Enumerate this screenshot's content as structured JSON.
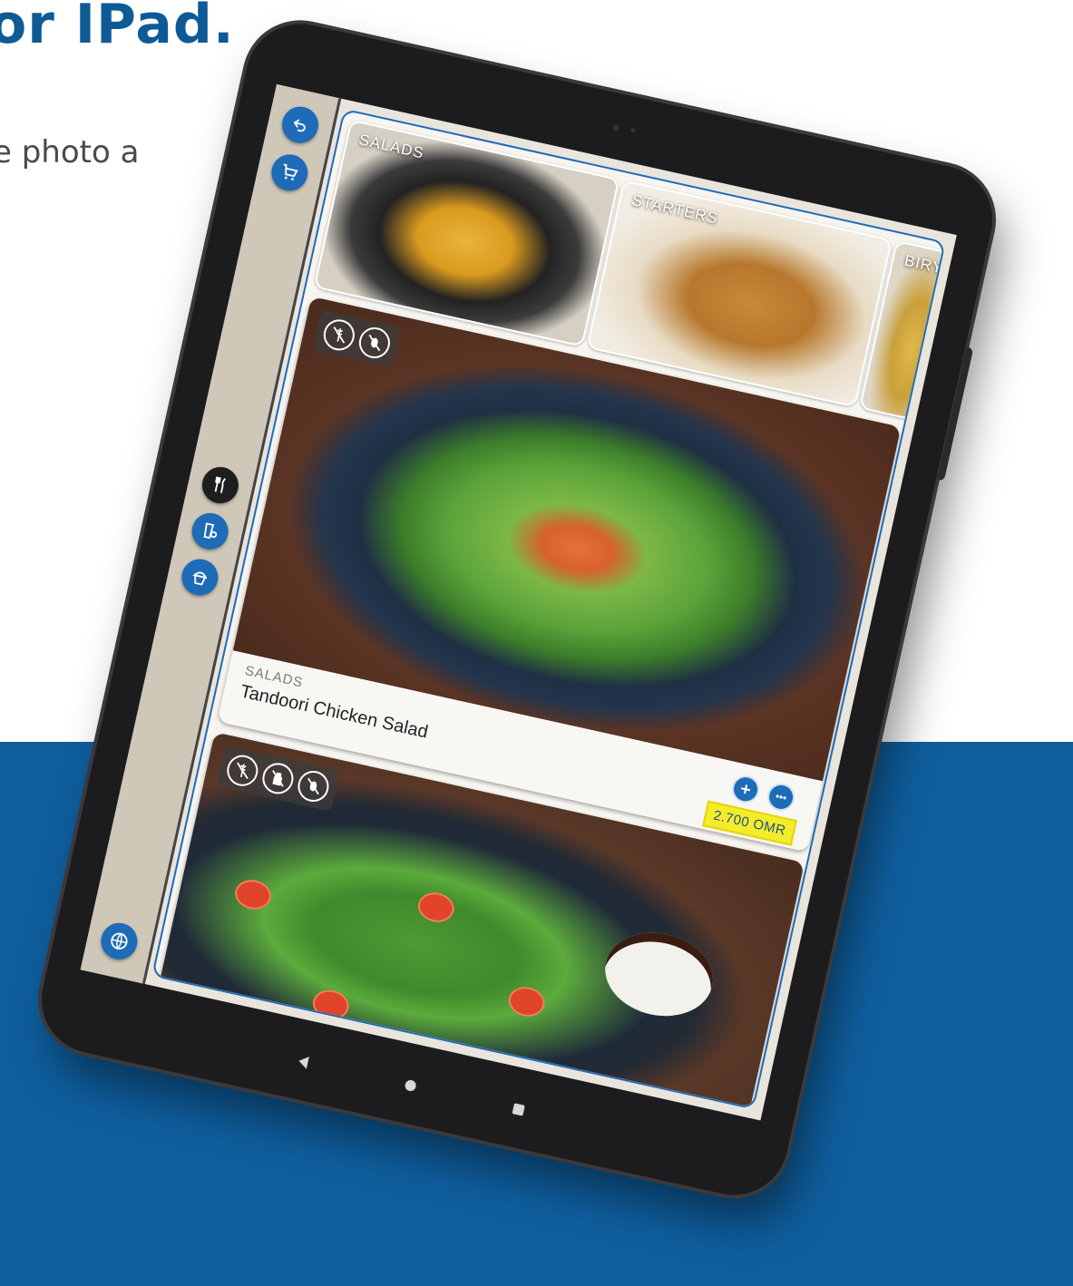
{
  "marketing": {
    "headline": "or IPad.",
    "subline": "e photo a"
  },
  "colors": {
    "brand_blue": "#0f5f9f",
    "button_blue": "#1e6bb8",
    "price_yellow": "#f4ec2a",
    "sidebar": "#cfc7b8"
  },
  "sidebar": {
    "top_buttons": [
      {
        "icon": "back-arrow-icon"
      },
      {
        "icon": "cart-icon"
      }
    ],
    "menu_buttons": [
      {
        "icon": "fork-knife-icon",
        "active": true
      },
      {
        "icon": "drinks-icon"
      },
      {
        "icon": "cupcake-icon"
      }
    ],
    "bottom_button": {
      "icon": "globe-icon"
    }
  },
  "categories": [
    {
      "label": "SALADS"
    },
    {
      "label": "STARTERS"
    },
    {
      "label": "BIRY"
    }
  ],
  "dishes": [
    {
      "category": "SALADS",
      "name": "Tandoori Chicken Salad",
      "price": "2.700 OMR",
      "badges": [
        "no-gluten-icon",
        "no-nuts-icon"
      ]
    },
    {
      "badges": [
        "no-gluten-icon",
        "no-dairy-icon",
        "no-nuts-icon"
      ]
    }
  ],
  "system_nav": [
    "back-nav-icon",
    "home-nav-icon",
    "recents-nav-icon"
  ]
}
